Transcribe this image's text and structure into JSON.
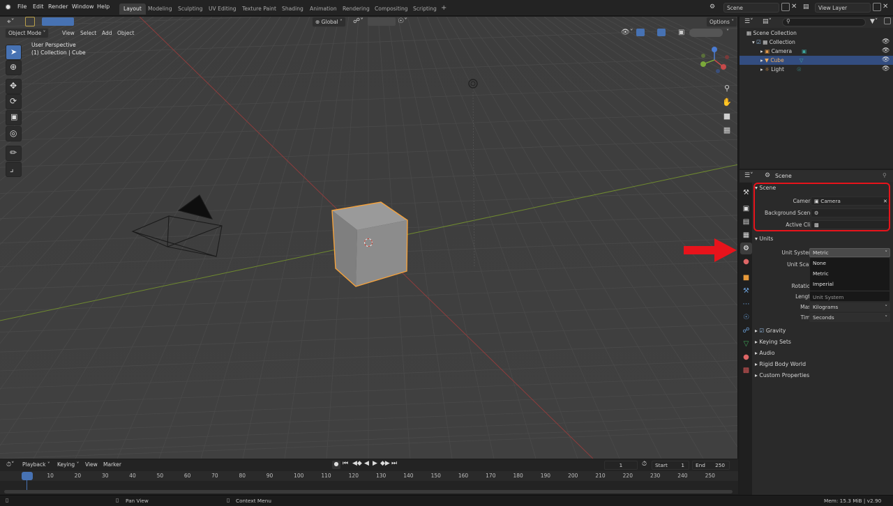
{
  "topbar": {
    "menus": [
      "File",
      "Edit",
      "Render",
      "Window",
      "Help"
    ],
    "workspaces": [
      "Layout",
      "Modeling",
      "Sculpting",
      "UV Editing",
      "Texture Paint",
      "Shading",
      "Animation",
      "Rendering",
      "Compositing",
      "Scripting"
    ],
    "add_tab_glyph": "+",
    "scene_name": "Scene",
    "view_layer": "View Layer"
  },
  "viewport": {
    "mode": "Object Mode",
    "menus": [
      "View",
      "Select",
      "Add",
      "Object"
    ],
    "transform_orientation": "Global",
    "options_label": "Options",
    "overlay_title": "User Perspective",
    "overlay_subtitle": "(1) Collection | Cube",
    "gizmo_axes": [
      "X",
      "Y",
      "Z"
    ]
  },
  "outliner": {
    "search_placeholder": "",
    "items": [
      {
        "label": "Scene Collection",
        "depth": 0
      },
      {
        "label": "Collection",
        "depth": 1
      },
      {
        "label": "Camera",
        "depth": 2
      },
      {
        "label": "Cube",
        "depth": 2,
        "selected": true
      },
      {
        "label": "Light",
        "depth": 2
      }
    ]
  },
  "properties": {
    "context_name": "Scene",
    "scene_panel": {
      "title": "Scene",
      "camera_label": "Camera",
      "camera_value": "Camera",
      "background_label": "Background Scene",
      "active_clip_label": "Active Clip"
    },
    "units_panel": {
      "title": "Units",
      "unit_system_label": "Unit System",
      "unit_system_value": "Metric",
      "unit_scale_label": "Unit Scale",
      "rotation_label": "Rotation",
      "length_label": "Length",
      "mass_label": "Mass",
      "mass_value": "Kilograms",
      "time_label": "Time",
      "time_value": "Seconds"
    },
    "dropdown": {
      "options": [
        "None",
        "Metric",
        "Imperial"
      ],
      "tooltip": "Unit System"
    },
    "collapsed_panels": [
      {
        "label": "Gravity",
        "checkbox": true
      },
      {
        "label": "Keying Sets"
      },
      {
        "label": "Audio"
      },
      {
        "label": "Rigid Body World"
      },
      {
        "label": "Custom Properties"
      }
    ]
  },
  "timeline": {
    "menus": [
      "Playback",
      "Keying",
      "View",
      "Marker"
    ],
    "current_frame": "1",
    "start_label": "Start",
    "start_value": "1",
    "end_label": "End",
    "end_value": "250",
    "ticks": [
      "1",
      "10",
      "20",
      "30",
      "40",
      "50",
      "60",
      "70",
      "80",
      "90",
      "100",
      "110",
      "120",
      "130",
      "140",
      "150",
      "160",
      "170",
      "180",
      "190",
      "200",
      "210",
      "220",
      "230",
      "240",
      "250"
    ]
  },
  "statusbar": {
    "pan_view": "Pan View",
    "context_menu": "Context Menu",
    "memory": "Mem: 15.3 MiB | v2.90"
  },
  "annotations": {
    "highlight_color": "#e8131b",
    "arrow_color": "#e8131b"
  },
  "colors": {
    "accent_blue": "#4772b3",
    "selection_orange": "#f5a23c",
    "x_axis": "#9a3a3a",
    "y_axis": "#6a8a2e"
  }
}
